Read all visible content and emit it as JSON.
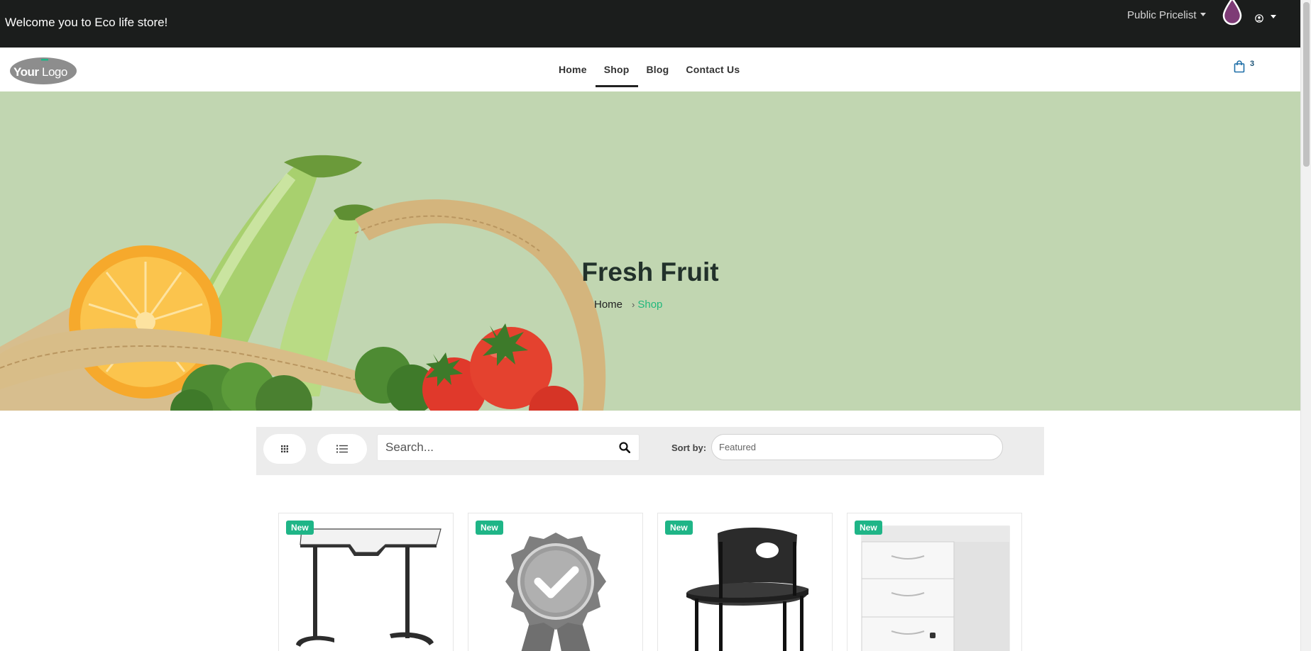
{
  "topbar": {
    "welcome": "Welcome you to Eco life store!",
    "pricelist": "Public Pricelist",
    "drop_icon": "ink-drop-icon",
    "user_icon": "user-circle-icon"
  },
  "navbar": {
    "logo_text": "YourLogo",
    "links": [
      {
        "label": "Home"
      },
      {
        "label": "Shop"
      },
      {
        "label": "Blog"
      },
      {
        "label": "Contact Us"
      }
    ],
    "active": "Shop",
    "cart_icon": "shopping-bag-icon",
    "cart_count": "3"
  },
  "hero": {
    "title": "Fresh Fruit",
    "breadcrumb": {
      "home": "Home",
      "separator": "›",
      "current": "Shop"
    }
  },
  "toolbar": {
    "grid_icon": "grid-view-icon",
    "list_icon": "list-view-icon",
    "search_placeholder": "Search...",
    "search_icon": "search-icon",
    "sort_label": "Sort by:",
    "sort_value": "Featured"
  },
  "products": [
    {
      "badge": "New",
      "image": "desk"
    },
    {
      "badge": "New",
      "image": "award-badge"
    },
    {
      "badge": "New",
      "image": "chair"
    },
    {
      "badge": "New",
      "image": "drawer-cabinet"
    }
  ],
  "colors": {
    "topbar_bg": "#1b1d1c",
    "hero_bg": "#c1d6b1",
    "accent": "#21b87c",
    "badge": "#1fb587"
  }
}
